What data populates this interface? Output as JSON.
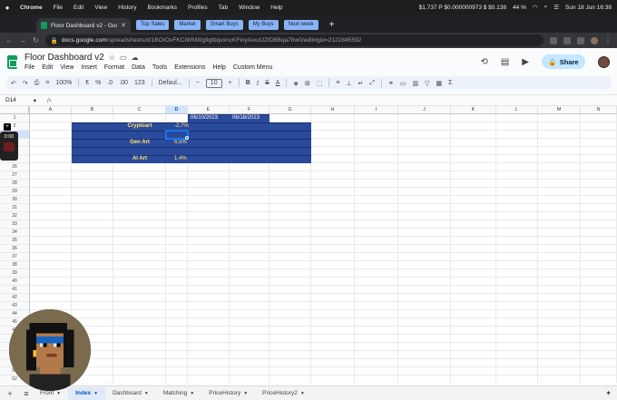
{
  "mac_menubar": {
    "app": "Chrome",
    "items": [
      "File",
      "Edit",
      "View",
      "History",
      "Bookmarks",
      "Profiles",
      "Tab",
      "Window",
      "Help"
    ],
    "status_text": "$1,737 P $0.000000973 $ $0.138",
    "battery": "44 %",
    "datetime": "Sun 18 Jun  16:38"
  },
  "browser": {
    "tab_title": "Floor Dashboard v2 - Google S",
    "bookmarks": [
      "Top Sales",
      "Market",
      "Smart Buys",
      "My Buys",
      "Next week"
    ],
    "url_host": "docs.google.com",
    "url_path": "/spreadsheets/d/1BOrOvFKCiWNWg9gfdqvxncKFinyAocdJZtD6Bqa78w0/edit#gid=2122845592"
  },
  "sheets": {
    "doc_title": "Floor Dashboard v2",
    "menus": [
      "File",
      "Edit",
      "View",
      "Insert",
      "Format",
      "Data",
      "Tools",
      "Extensions",
      "Help",
      "Custom Menu"
    ],
    "share_label": "Share",
    "toolbar": {
      "zoom": "100%",
      "currency": "€",
      "percent": "%",
      "dec_less": ".0",
      "dec_more": ".00",
      "num_fmt": "123",
      "font": "Defaul...",
      "font_size": "10",
      "bold": "B",
      "italic": "I",
      "strike": "S",
      "text_color": "A"
    },
    "name_box": "D14",
    "fx": "fx",
    "columns": [
      "A",
      "B",
      "C",
      "D",
      "E",
      "F",
      "G",
      "H",
      "I",
      "J",
      "K",
      "L",
      "M",
      "N"
    ],
    "selected_column": "D",
    "rows": [
      "1",
      "2",
      "15",
      "16",
      "24",
      "25",
      "26",
      "27",
      "28",
      "29",
      "30",
      "31",
      "32",
      "33",
      "34",
      "35",
      "36",
      "37",
      "38",
      "39",
      "40",
      "41",
      "42",
      "43",
      "44",
      "45",
      "46",
      "47",
      "48",
      "49",
      "50",
      "51",
      "52",
      "53"
    ],
    "selected_row": "15",
    "group_controls": [
      "+",
      "−",
      "+",
      "−"
    ],
    "header_dates": [
      "06/10/2023",
      "06/18/2023"
    ],
    "categories": [
      {
        "name": "Cryptoart",
        "change": "-2,7%"
      },
      {
        "name": "Gen Art",
        "change": "6,5%"
      },
      {
        "name": "AI Art",
        "change": "1,4%"
      }
    ],
    "sheet_tabs": [
      "Front",
      "Index",
      "Dashboard",
      "Matching",
      "PriceHistory",
      "PriceHistory2"
    ],
    "active_tab": "Index"
  },
  "overlay": {
    "recorder_time": "0:00"
  },
  "colors": {
    "block_blue": "#2a4a9c",
    "label_yellow": "#fbe36b",
    "selection": "#1a73e8"
  }
}
